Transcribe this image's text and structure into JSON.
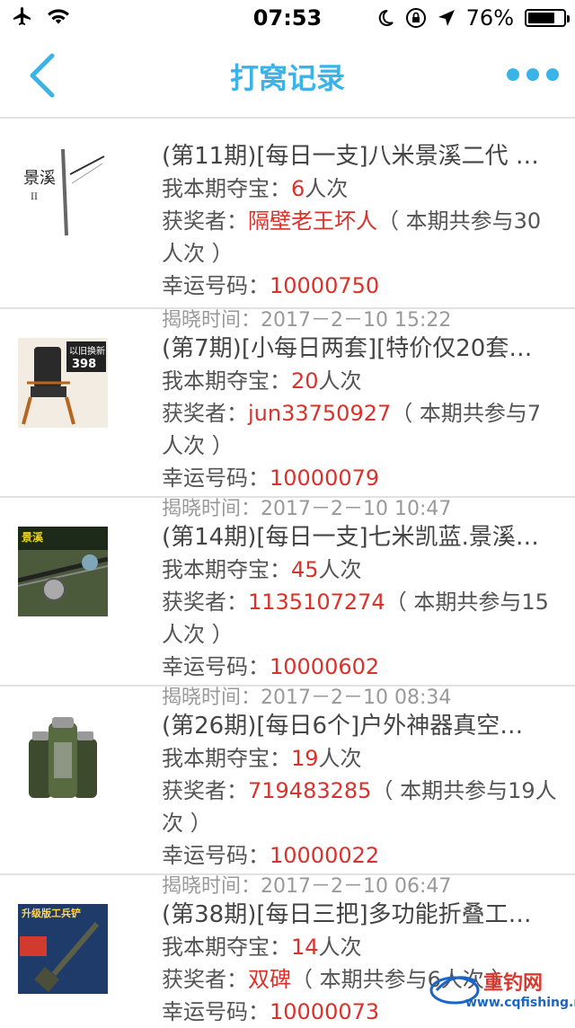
{
  "status": {
    "time": "07:53",
    "battery": "76%",
    "battery_level": 0.76
  },
  "nav": {
    "title": "打窝记录"
  },
  "labels": {
    "reveal_time": "揭晓时间：",
    "my_bet": "我本期夺宝：",
    "winner": "获奖者：",
    "lucky": "幸运号码：",
    "count_suffix": "人次"
  },
  "records": [
    {
      "title": "(第11期)[每日一支]八米景溪二代 …",
      "my_count": "6",
      "winner": "隔壁老王坏人",
      "participants": "（ 本期共参与30人次 ）",
      "lucky_number": "10000750"
    },
    {
      "reveal_time": "2017－2－10 15:22",
      "title": "(第7期)[小每日两套][特价仅20套…",
      "my_count": "20",
      "winner": "jun33750927",
      "participants": "（ 本期共参与7人次 ）",
      "lucky_number": "10000079"
    },
    {
      "reveal_time": "2017－2－10 10:47",
      "title": "(第14期)[每日一支]七米凯蓝.景溪…",
      "my_count": "45",
      "winner": "1135107274",
      "participants": "（ 本期共参与15人次 ）",
      "lucky_number": "10000602"
    },
    {
      "reveal_time": "2017－2－10 08:34",
      "title": "(第26期)[每日6个]户外神器真空…",
      "my_count": "19",
      "winner": "719483285",
      "participants": "（ 本期共参与19人次 ）",
      "lucky_number": "10000022"
    },
    {
      "reveal_time": "2017－2－10 06:47",
      "title": "(第38期)[每日三把]多功能折叠工…",
      "my_count": "14",
      "winner": "双碑",
      "participants": "（ 本期共参与6人次 ）",
      "lucky_number": "10000073"
    }
  ],
  "thumbs": {
    "rod_logo": "景溪",
    "rod_logo_sub": "II",
    "chair_brand": "以旧换新",
    "chair_num": "398",
    "rod2_brand": "景溪",
    "shovel_text": "升级版工兵铲"
  },
  "watermark": {
    "name": "重钓网",
    "url": "www.cqfishing.net"
  }
}
